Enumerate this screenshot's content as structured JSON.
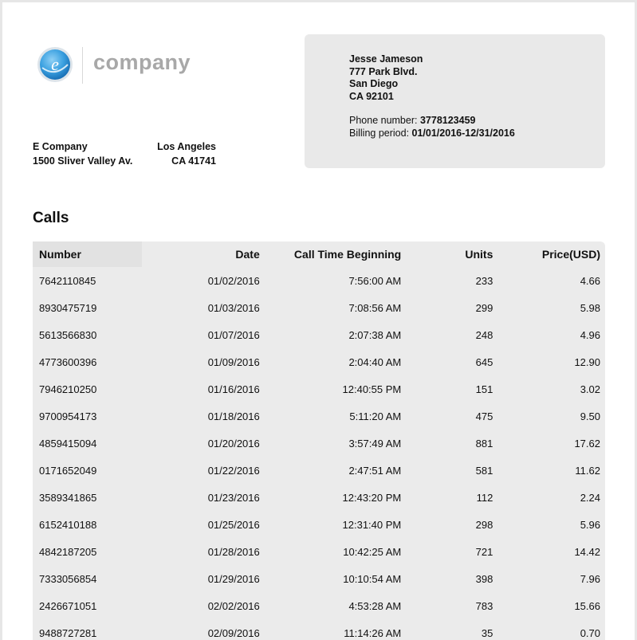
{
  "company": {
    "logo_text": "company",
    "name": "E Company",
    "city": "Los Angeles",
    "street": "1500 Sliver Valley Av.",
    "state_zip": "CA 41741",
    "logo_color": "#3aa0e0"
  },
  "recipient": {
    "name": "Jesse Jameson",
    "street": "777 Park Blvd.",
    "city": "San Diego",
    "state_zip": "CA 92101",
    "phone_label": "Phone number:",
    "phone_value": "3778123459",
    "billing_label": "Billing period:",
    "billing_value": "01/01/2016-12/31/2016"
  },
  "calls": {
    "title": "Calls",
    "headers": [
      "Number",
      "Date",
      "Call Time Beginning",
      "Units",
      "Price(USD)"
    ],
    "rows": [
      [
        "7642110845",
        "01/02/2016",
        "7:56:00 AM",
        "233",
        "4.66"
      ],
      [
        "8930475719",
        "01/03/2016",
        "7:08:56 AM",
        "299",
        "5.98"
      ],
      [
        "5613566830",
        "01/07/2016",
        "2:07:38 AM",
        "248",
        "4.96"
      ],
      [
        "4773600396",
        "01/09/2016",
        "2:04:40 AM",
        "645",
        "12.90"
      ],
      [
        "7946210250",
        "01/16/2016",
        "12:40:55 PM",
        "151",
        "3.02"
      ],
      [
        "9700954173",
        "01/18/2016",
        "5:11:20 AM",
        "475",
        "9.50"
      ],
      [
        "4859415094",
        "01/20/2016",
        "3:57:49 AM",
        "881",
        "17.62"
      ],
      [
        "0171652049",
        "01/22/2016",
        "2:47:51 AM",
        "581",
        "11.62"
      ],
      [
        "3589341865",
        "01/23/2016",
        "12:43:20 PM",
        "112",
        "2.24"
      ],
      [
        "6152410188",
        "01/25/2016",
        "12:31:40 PM",
        "298",
        "5.96"
      ],
      [
        "4842187205",
        "01/28/2016",
        "10:42:25 AM",
        "721",
        "14.42"
      ],
      [
        "7333056854",
        "01/29/2016",
        "10:10:54 AM",
        "398",
        "7.96"
      ],
      [
        "2426671051",
        "02/02/2016",
        "4:53:28 AM",
        "783",
        "15.66"
      ],
      [
        "9488727281",
        "02/09/2016",
        "11:14:26 AM",
        "35",
        "0.70"
      ]
    ]
  }
}
